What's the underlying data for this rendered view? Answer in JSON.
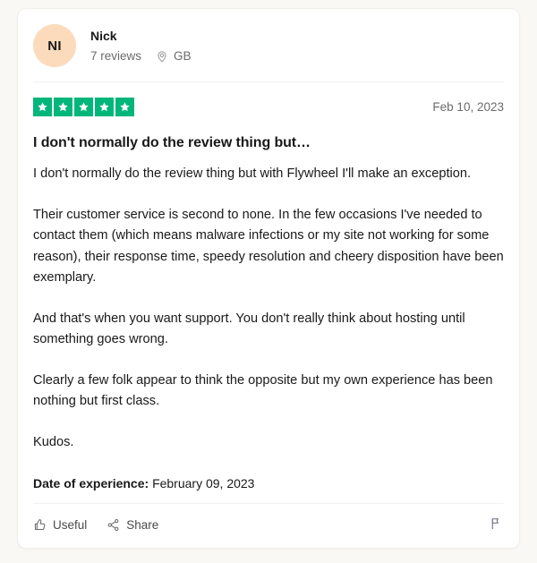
{
  "review": {
    "consumer": {
      "avatar_initials": "NI",
      "avatar_color": "#fbdbbb",
      "name": "Nick",
      "review_count": "7 reviews",
      "location": "GB",
      "location_icon": "map-pin-icon"
    },
    "rating": {
      "stars": 5,
      "star_color": "#00b67a",
      "star_icon": "star-icon"
    },
    "date": "Feb 10, 2023",
    "title": "I don't normally do the review thing but…",
    "paragraphs": [
      "I don't normally do the review thing but with Flywheel I'll make an exception.",
      "Their customer service is second to none. In the few occasions I've needed to contact them (which means malware infections or my site not working for some reason), their response time, speedy resolution and cheery disposition have been exemplary.",
      "And that's when you want support. You don't really think about hosting until something goes wrong.",
      "Clearly a few folk appear to think the opposite but my own experience has been nothing but first class.",
      "Kudos."
    ],
    "date_of_experience": {
      "label": "Date of experience:",
      "value": "February 09, 2023"
    },
    "footer": {
      "useful_label": "Useful",
      "useful_icon": "thumbs-up-icon",
      "share_label": "Share",
      "share_icon": "share-icon",
      "report_icon": "flag-icon"
    }
  }
}
